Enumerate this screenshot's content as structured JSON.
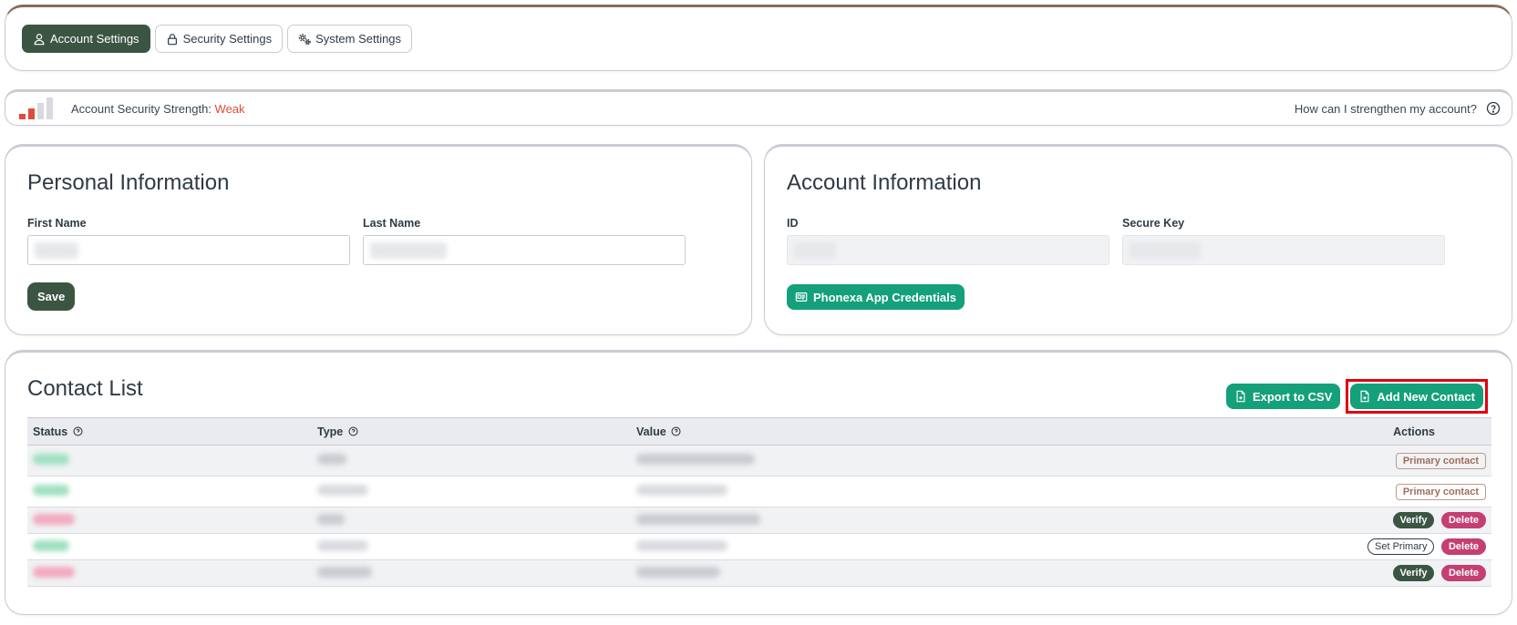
{
  "tabs": [
    {
      "label": "Account Settings",
      "icon": "user-icon",
      "active": true
    },
    {
      "label": "Security Settings",
      "icon": "lock-icon",
      "active": false
    },
    {
      "label": "System Settings",
      "icon": "gears-icon",
      "active": false
    }
  ],
  "security": {
    "label": "Account Security Strength:",
    "value": "Weak",
    "value_color": "#e04b3c",
    "level": 2,
    "max_level": 4,
    "help_text": "How can I strengthen my account?"
  },
  "personal": {
    "title": "Personal Information",
    "first_name_label": "First Name",
    "last_name_label": "Last Name",
    "save_label": "Save"
  },
  "account": {
    "title": "Account Information",
    "id_label": "ID",
    "secure_key_label": "Secure Key",
    "credentials_label": "Phonexa App Credentials"
  },
  "contacts": {
    "title": "Contact List",
    "export_label": "Export to CSV",
    "add_label": "Add New Contact",
    "columns": {
      "status": "Status",
      "type": "Type",
      "value": "Value",
      "actions": "Actions"
    },
    "rows": [
      {
        "actions": [
          "Primary contact"
        ]
      },
      {
        "actions": [
          "Primary contact"
        ]
      },
      {
        "actions": [
          "Verify",
          "Delete"
        ]
      },
      {
        "actions": [
          "Set Primary",
          "Delete"
        ]
      },
      {
        "actions": [
          "Verify",
          "Delete"
        ]
      }
    ]
  },
  "colors": {
    "brand_dark": "#3b5543",
    "accent_green": "#14a07a",
    "danger_pink": "#c43f72",
    "highlight_red": "#e0000f"
  }
}
